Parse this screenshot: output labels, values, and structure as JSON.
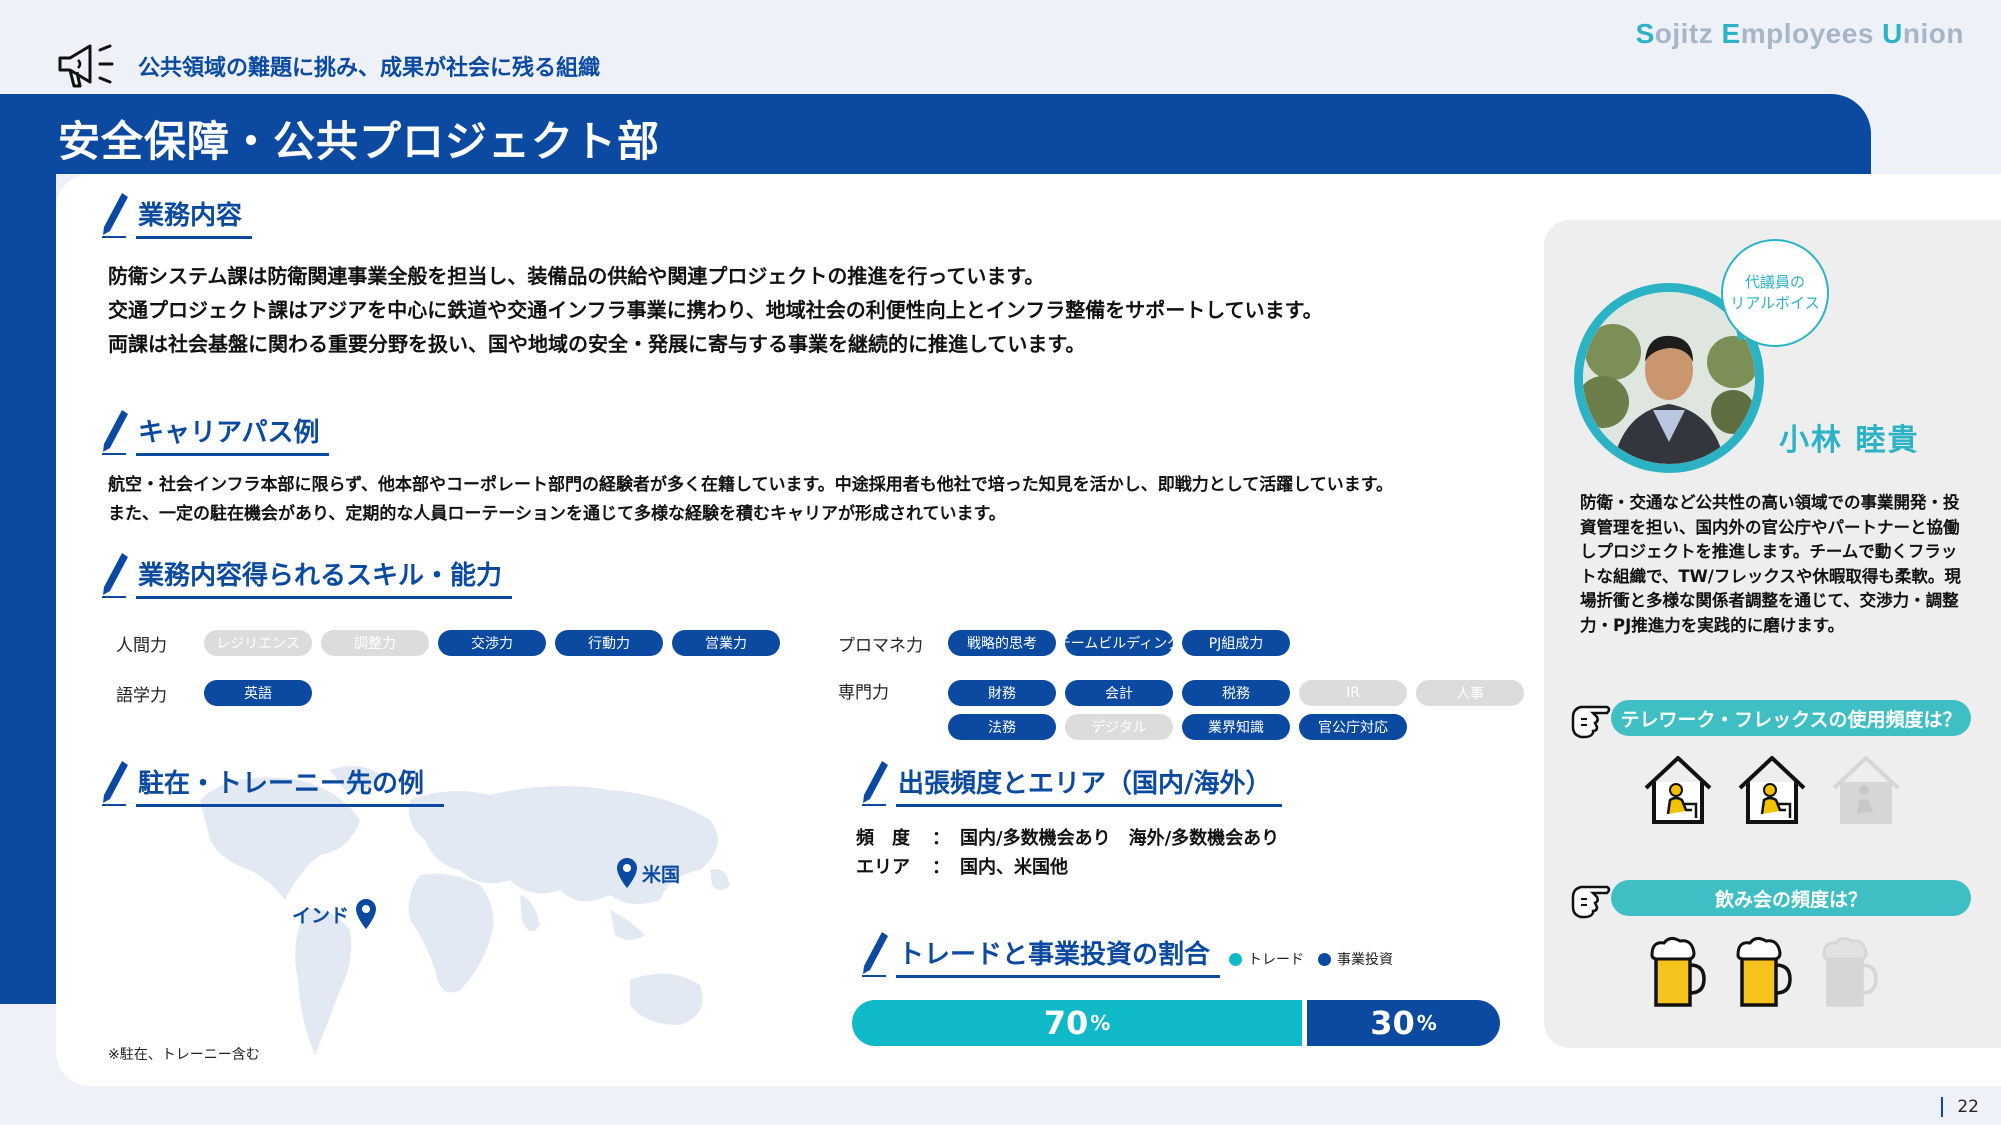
{
  "brand": {
    "parts": [
      {
        "cap": "S",
        "rest": "ojitz "
      },
      {
        "cap": "E",
        "rest": "mployees "
      },
      {
        "cap": "U",
        "rest": "nion"
      }
    ]
  },
  "header": {
    "tagline": "公共領域の難題に挑み、成果が社会に残る組織",
    "title": "安全保障・公共プロジェクト部"
  },
  "business": {
    "heading": "業務内容",
    "lines": [
      "防衛システム課は防衛関連事業全般を担当し、装備品の供給や関連プロジェクトの推進を行っています。",
      "交通プロジェクト課はアジアを中心に鉄道や交通インフラ事業に携わり、地域社会の利便性向上とインフラ整備をサポートしています。",
      "両課は社会基盤に関わる重要分野を扱い、国や地域の安全・発展に寄与する事業を継続的に推進しています。"
    ]
  },
  "career": {
    "heading": "キャリアパス例",
    "lines": [
      "航空・社会インフラ本部に限らず、他本部やコーポレート部門の経験者が多く在籍しています。中途採用者も他社で培った知見を活かし、即戦力として活躍しています。",
      "また、一定の駐在機会があり、定期的な人員ローテーションを通じて多様な経験を積むキャリアが形成されています。"
    ]
  },
  "skills": {
    "heading": "業務内容得られるスキル・能力",
    "groups": {
      "human": {
        "label": "人間力",
        "items": [
          {
            "text": "レジリエンス",
            "on": false
          },
          {
            "text": "調整力",
            "on": false
          },
          {
            "text": "交渉力",
            "on": true
          },
          {
            "text": "行動力",
            "on": true
          },
          {
            "text": "営業力",
            "on": true
          }
        ]
      },
      "language": {
        "label": "語学力",
        "items": [
          {
            "text": "英語",
            "on": true
          }
        ]
      },
      "pm": {
        "label": "プロマネ力",
        "items": [
          {
            "text": "戦略的思考",
            "on": true
          },
          {
            "text": "チームビルディング",
            "on": true
          },
          {
            "text": "PJ組成力",
            "on": true
          }
        ]
      },
      "expert": {
        "label": "専門力",
        "items": [
          {
            "text": "財務",
            "on": true
          },
          {
            "text": "会計",
            "on": true
          },
          {
            "text": "税務",
            "on": true
          },
          {
            "text": "IR",
            "on": false
          },
          {
            "text": "人事",
            "on": false
          },
          {
            "text": "法務",
            "on": true
          },
          {
            "text": "デジタル",
            "on": false
          },
          {
            "text": "業界知識",
            "on": true
          },
          {
            "text": "官公庁対応",
            "on": true
          }
        ]
      }
    }
  },
  "posting": {
    "heading": "駐在・トレーニー先の例",
    "pins": {
      "india": "インド",
      "usa": "米国"
    },
    "note": "※駐在、トレーニー含む"
  },
  "travel": {
    "heading": "出張頻度とエリア（国内/海外）",
    "freq_label": "頻　度",
    "freq_value": "国内/多数機会あり　海外/多数機会あり",
    "area_label": "エリア",
    "area_value": "国内、米国他",
    "sep": "："
  },
  "ratio": {
    "heading": "トレードと事業投資の割合",
    "legend": [
      {
        "name": "トレード",
        "color": "#0fb9c8"
      },
      {
        "name": "事業投資",
        "color": "#0b4aa0"
      }
    ],
    "trade_value": "70",
    "investment_value": "30",
    "unit": "%"
  },
  "representative": {
    "bubble_line1": "代議員の",
    "bubble_line2": "リアルボイス",
    "name": "小林 睦貴",
    "description": "防衛・交通など公共性の高い領域での事業開発・投資管理を担い、国内外の官公庁やパートナーと協働しプロジェクトを推進します。チームで動くフラットな組織で、TW/フレックスや休暇取得も柔軟。現場折衝と多様な関係者調整を通じて、交渉力・調整力・PJ推進力を実践的に磨けます。"
  },
  "survey": {
    "telework_q": "テレワーク・フレックスの使用頻度は？",
    "telework_level": 2,
    "telework_max": 3,
    "drink_q": "飲み会の頻度は？",
    "drink_level": 2,
    "drink_max": 3
  },
  "page": {
    "number": "22"
  },
  "colors": {
    "navy": "#0b4aa0",
    "teal": "#2bb3c5",
    "cyan": "#0fb9c8",
    "gray": "#dcdcdc"
  }
}
